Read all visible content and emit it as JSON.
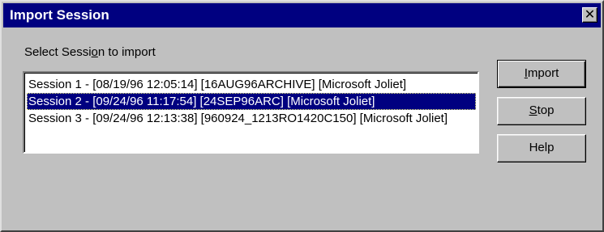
{
  "window": {
    "title": "Import Session",
    "close_glyph": "✕"
  },
  "prompt": {
    "before": "Select Sessi",
    "mnemonic": "o",
    "after": "n to import"
  },
  "sessions": [
    "Session 1 -  [08/19/96 12:05:14]   [16AUG96ARCHIVE]   [Microsoft Joliet]",
    "Session 2 -  [09/24/96 11:17:54]   [24SEP96ARC]   [Microsoft Joliet]",
    "Session 3 -  [09/24/96 12:13:38]   [960924_1213RO1420C150]   [Microsoft Joliet]"
  ],
  "selected_session_index": 1,
  "buttons": {
    "import": {
      "mnemonic": "I",
      "rest": "mport"
    },
    "stop": {
      "mnemonic": "S",
      "rest": "top"
    },
    "help": {
      "label": "Help"
    }
  },
  "colors": {
    "titlebar": "#000080",
    "face": "#c0c0c0",
    "selection": "#000080"
  }
}
